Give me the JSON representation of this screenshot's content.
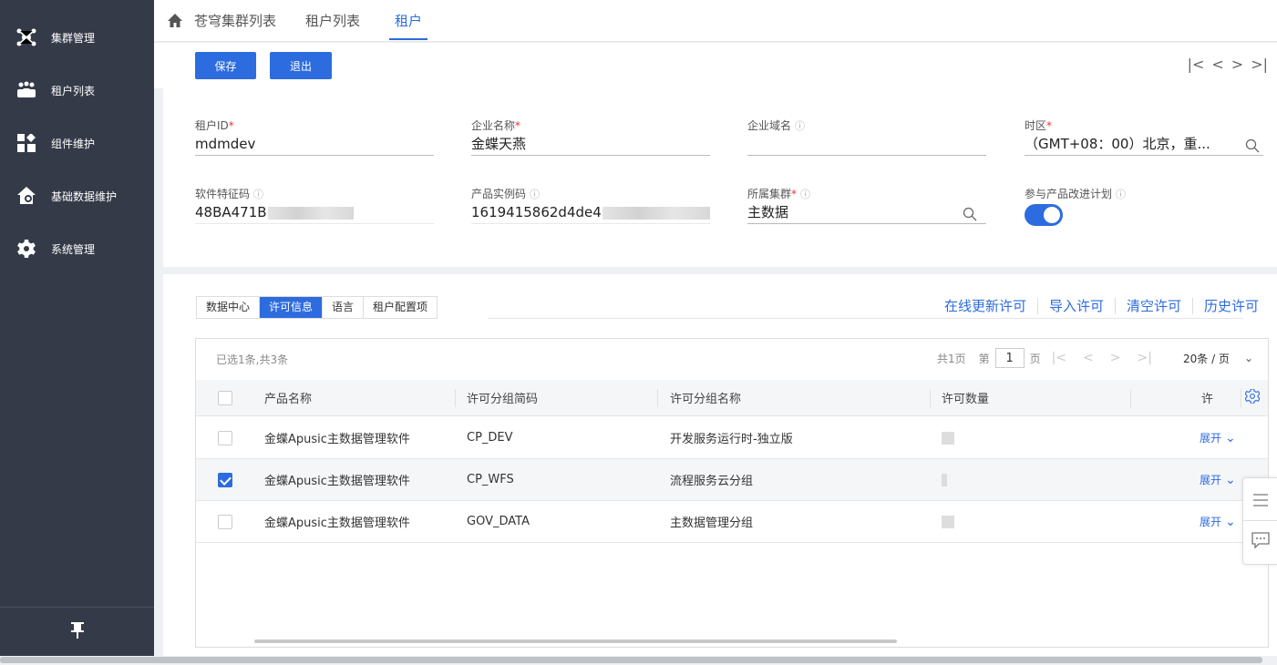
{
  "sidebar": {
    "items": [
      {
        "label": "集群管理",
        "icon": "cluster-icon"
      },
      {
        "label": "租户列表",
        "icon": "users-icon"
      },
      {
        "label": "组件维护",
        "icon": "components-icon"
      },
      {
        "label": "基础数据维护",
        "icon": "home-settings-icon"
      },
      {
        "label": "系统管理",
        "icon": "gear-icon"
      }
    ],
    "pin_icon": "pin-icon"
  },
  "nav": {
    "tabs": [
      "苍穹集群列表",
      "租户列表",
      "租户"
    ],
    "active_tab": "租户"
  },
  "toolbar": {
    "save_label": "保存",
    "exit_label": "退出",
    "record_nav": [
      "|<",
      "<",
      ">",
      ">|"
    ]
  },
  "form": {
    "tenant_id": {
      "label": "租户ID",
      "value": "mdmdev"
    },
    "company_name": {
      "label": "企业名称",
      "value": "金蝶天燕"
    },
    "company_domain": {
      "label": "企业域名",
      "value": ""
    },
    "timezone": {
      "label": "时区",
      "value": "（GMT+08：00）北京，重..."
    },
    "software_code": {
      "label": "软件特征码",
      "value": "48BA471B"
    },
    "product_instance": {
      "label": "产品实例码",
      "value": "1619415862d4de4"
    },
    "cluster": {
      "label": "所属集群",
      "value": "主数据"
    },
    "improvement_plan": {
      "label": "参与产品改进计划",
      "enabled": true
    }
  },
  "subtabs": {
    "items": [
      "数据中心",
      "许可信息",
      "语言",
      "租户配置项"
    ],
    "active": "许可信息"
  },
  "actions": [
    "在线更新许可",
    "导入许可",
    "清空许可",
    "历史许可"
  ],
  "table": {
    "summary": "已选1条,共3条",
    "pager": {
      "total_pages": "共1页",
      "page_prefix": "第",
      "page": "1",
      "page_suffix": "页",
      "page_size": "20条 / 页"
    },
    "columns": [
      "产品名称",
      "许可分组简码",
      "许可分组名称",
      "许可数量",
      "许"
    ],
    "rows": [
      {
        "product": "金蝶Apusic主数据管理软件",
        "code": "CP_DEV",
        "name": "开发服务运行时-独立版",
        "expand": "展开",
        "checked": false
      },
      {
        "product": "金蝶Apusic主数据管理软件",
        "code": "CP_WFS",
        "name": "流程服务云分组",
        "expand": "展开",
        "checked": true
      },
      {
        "product": "金蝶Apusic主数据管理软件",
        "code": "GOV_DATA",
        "name": "主数据管理分组",
        "expand": "展开",
        "checked": false
      }
    ]
  },
  "colors": {
    "accent": "#2d6cdf",
    "sidebar": "#353a48",
    "required": "#e33333"
  }
}
